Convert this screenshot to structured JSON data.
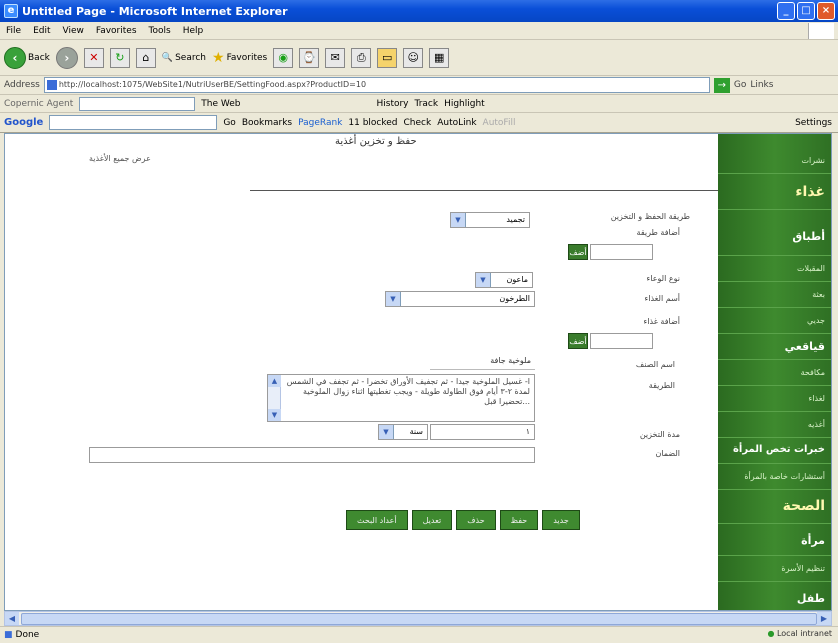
{
  "window": {
    "title": "Untitled Page - Microsoft Internet Explorer"
  },
  "menu": [
    "File",
    "Edit",
    "View",
    "Favorites",
    "Tools",
    "Help"
  ],
  "toolbar": {
    "back": "Back",
    "search": "Search",
    "favorites": "Favorites"
  },
  "address": {
    "label": "Address",
    "url": "http://localhost:1075/WebSite1/NutriUserBE/SettingFood.aspx?ProductID=10",
    "go": "Go",
    "links": "Links"
  },
  "copernic": {
    "label": "Copernic Agent",
    "theweb": "The Web",
    "history": "History",
    "track": "Track",
    "highlight": "Highlight"
  },
  "google": {
    "logo": "Google",
    "go": "Go",
    "bookmarks": "Bookmarks",
    "pagerank": "PageRank",
    "blocked": "11 blocked",
    "check": "Check",
    "autolink": "AutoLink",
    "autofill": "AutoFill",
    "settings": "Settings"
  },
  "page": {
    "header": "حفظ و تخزين أغذية",
    "show_link": "عرض جميع الأغذية",
    "fields": {
      "storage_method_label": "طريقة الحفظ و التخزين",
      "storage_method_value": "تجميد",
      "add_method_label": "أضافة طريقة",
      "add_button": "أضف",
      "container_type_label": "نوع الوعاء",
      "container_type_value": "ماعون",
      "food_name_label": "أسم الغذاء",
      "food_name_value": "الطرخون",
      "add_food_label": "أضافة غذاء",
      "add_food_button": "أضف",
      "dish_name_label": "اسم الصنف",
      "dish_name_value": "ملوخية جافة",
      "method_label": "الطريقة",
      "method_text": "ا- غسيل الملوخية جيدا - ثم تجفيف الأوراق تخضرا - ثم تجفف في الشمس لمدة ٢-٣ أيام فوق الطاولة طويلة - ويجب تغطيتها اثناء زوال الملوخية تحضيرا قبل...",
      "duration_label": "مدة التخزين",
      "duration_value": "١",
      "duration_unit": "سنة",
      "notes_label": "الضمان",
      "notes_value": ""
    },
    "buttons": {
      "new": "جديد",
      "save": "حفظ",
      "delete": "حذف",
      "edit": "تعديل",
      "back_list": "أعداد البحث"
    }
  },
  "sidebar": [
    {
      "label": "نشرات",
      "style": "small"
    },
    {
      "label": "غذاء",
      "style": "big"
    },
    {
      "label": "أطباق",
      "style": "mid"
    },
    {
      "label": "المقبلات",
      "style": "small"
    },
    {
      "label": "بعثة",
      "style": "small"
    },
    {
      "label": "جديي",
      "style": "small"
    },
    {
      "label": "قياقعي",
      "style": "mid"
    },
    {
      "label": "مكافحة",
      "style": "small"
    },
    {
      "label": "لغذاء",
      "style": "small"
    },
    {
      "label": "أغذيه",
      "style": "small"
    },
    {
      "label": "خبرات تخص المرأة",
      "style": "mid"
    },
    {
      "label": "أستشارات خاصة بالمرأة",
      "style": "small"
    },
    {
      "label": "الصحة",
      "style": "big"
    },
    {
      "label": "مرأة",
      "style": "mid"
    },
    {
      "label": "تنظيم الأسرة",
      "style": "small"
    },
    {
      "label": "طفل",
      "style": "mid"
    }
  ],
  "status": {
    "left": "Done",
    "right": "Local intranet"
  }
}
